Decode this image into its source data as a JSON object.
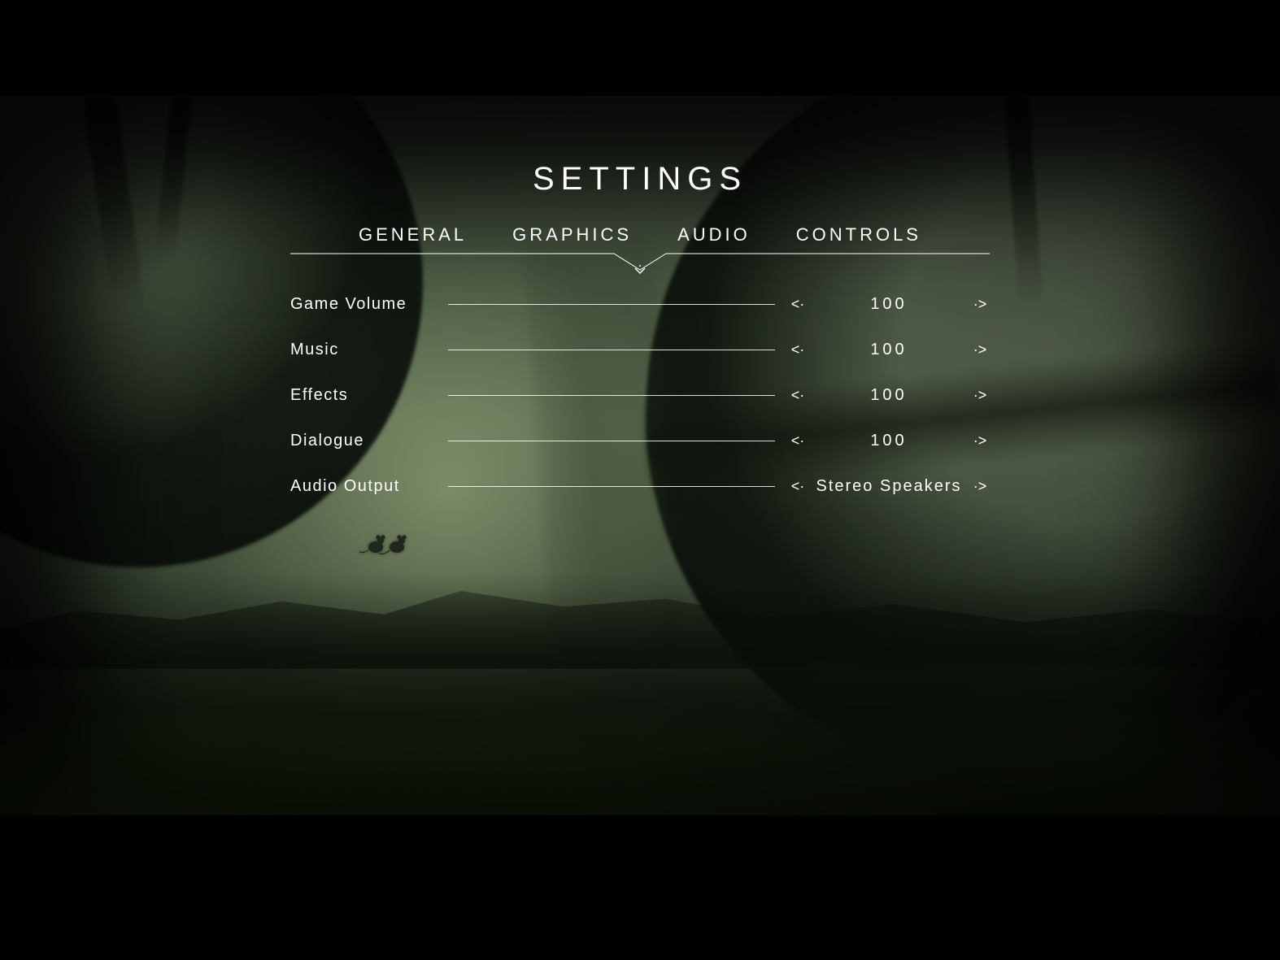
{
  "title": "SETTINGS",
  "tabs": {
    "general": "GENERAL",
    "graphics": "GRAPHICS",
    "audio": "AUDIO",
    "controls": "CONTROLS",
    "active": "audio"
  },
  "options": {
    "game_volume": {
      "label": "Game Volume",
      "value": "100"
    },
    "music": {
      "label": "Music",
      "value": "100"
    },
    "effects": {
      "label": "Effects",
      "value": "100"
    },
    "dialogue": {
      "label": "Dialogue",
      "value": "100"
    },
    "audio_output": {
      "label": "Audio Output",
      "value": "Stereo Speakers"
    }
  },
  "glyphs": {
    "arrow_left": "<·",
    "arrow_right": "·>"
  }
}
